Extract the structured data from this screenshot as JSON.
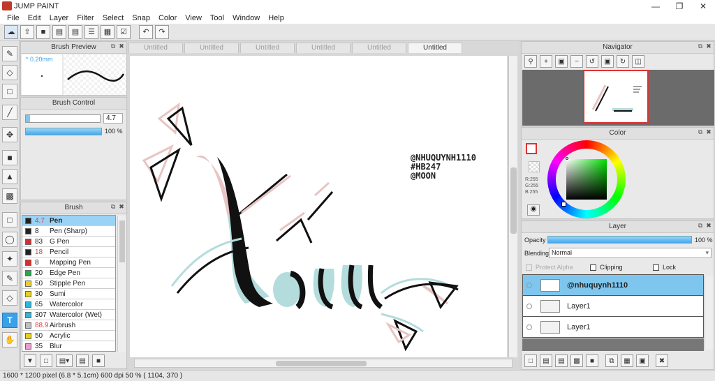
{
  "app": {
    "title": "JUMP PAINT"
  },
  "menu": [
    "File",
    "Edit",
    "Layer",
    "Filter",
    "Select",
    "Snap",
    "Color",
    "View",
    "Tool",
    "Window",
    "Help"
  ],
  "tabs": [
    "Untitled",
    "Untitled",
    "Untitled",
    "Untitled",
    "Untitled",
    "Untitled"
  ],
  "brush_preview": {
    "title": "Brush Preview",
    "size": "* 0.20mm"
  },
  "brush_control": {
    "title": "Brush Control",
    "size": "4.7",
    "opacity": "100 %"
  },
  "brush_list": {
    "title": "Brush",
    "items": [
      {
        "size": "4.7",
        "name": "Pen",
        "color": "#222222",
        "red": true
      },
      {
        "size": "8",
        "name": "Pen (Sharp)",
        "color": "#222222",
        "red": false
      },
      {
        "size": "83",
        "name": "G Pen",
        "color": "#d23030",
        "red": false
      },
      {
        "size": "18",
        "name": "Pencil",
        "color": "#222222",
        "red": true
      },
      {
        "size": "8",
        "name": "Mapping Pen",
        "color": "#d23030",
        "red": false
      },
      {
        "size": "20",
        "name": "Edge Pen",
        "color": "#27a84a",
        "red": false
      },
      {
        "size": "50",
        "name": "Stipple Pen",
        "color": "#e8d020",
        "red": false
      },
      {
        "size": "30",
        "name": "Sumi",
        "color": "#e8d020",
        "red": false
      },
      {
        "size": "65",
        "name": "Watercolor",
        "color": "#33b3d6",
        "red": false
      },
      {
        "size": "307",
        "name": "Watercolor (Wet)",
        "color": "#33b3d6",
        "red": false
      },
      {
        "size": "88.9",
        "name": "Airbrush",
        "color": "#bfbfbf",
        "red": true
      },
      {
        "size": "50",
        "name": "Acrylic",
        "color": "#e8d020",
        "red": false
      },
      {
        "size": "35",
        "name": "Blur",
        "color": "#e8a0c8",
        "red": false
      }
    ]
  },
  "navigator": {
    "title": "Navigator"
  },
  "color": {
    "title": "Color",
    "r": "R:255",
    "g": "G:255",
    "b": "B:255"
  },
  "layer": {
    "title": "Layer",
    "opacity_label": "Opacity",
    "opacity": "100 %",
    "blending_label": "Blending",
    "blending": "Normal",
    "protect_alpha": "Protect Alpha",
    "clipping": "Clipping",
    "lock": "Lock",
    "layers": [
      {
        "name": "@nhuquynh1110",
        "selected": true
      },
      {
        "name": "Layer1",
        "selected": false
      },
      {
        "name": "Layer1",
        "selected": false
      }
    ]
  },
  "canvas_text": {
    "line1": "@NHUQUYNH1110",
    "line2": "#HB247",
    "line3": "@MOON"
  },
  "status": {
    "text": "1600 * 1200 pixel   (6.8 * 5.1cm)   600 dpi   50 %   ( 1104, 370 )"
  },
  "colors": {
    "accent": "#3aa0e8",
    "pink": "#e8c4c4",
    "teal": "#b4dcdc"
  }
}
